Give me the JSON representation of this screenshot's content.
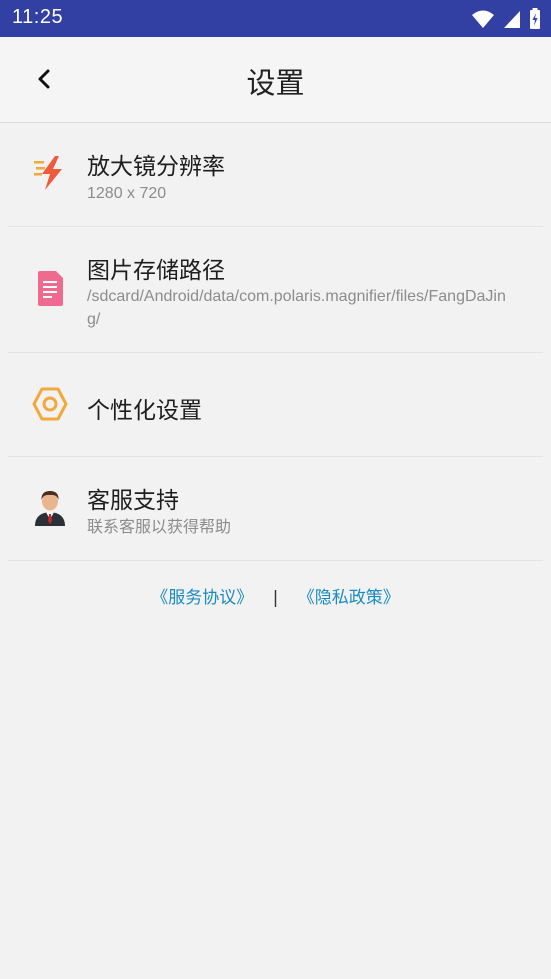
{
  "status_bar": {
    "time": "11:25",
    "icons": [
      "wifi-icon",
      "signal-icon",
      "battery-charging-icon"
    ]
  },
  "header": {
    "title": "设置",
    "back_icon": "back-arrow-icon"
  },
  "items": [
    {
      "icon": "lightning-icon",
      "label": "放大镜分辨率",
      "sub": "1280 x 720"
    },
    {
      "icon": "document-icon",
      "label": "图片存储路径",
      "sub": "/sdcard/Android/data/com.polaris.magnifier/files/FangDaJing/"
    },
    {
      "icon": "hexagon-settings-icon",
      "label": "个性化设置",
      "sub": ""
    },
    {
      "icon": "customer-service-icon",
      "label": "客服支持",
      "sub": "联系客服以获得帮助"
    }
  ],
  "links": {
    "service": "《服务协议》",
    "separator": "|",
    "privacy": "《隐私政策》"
  },
  "colors": {
    "status_bar": "#3340a3",
    "link": "#1a8bbf",
    "lightning": "#ef5a3c",
    "document": "#ef6a8f",
    "hexagon": "#f2a93b"
  }
}
